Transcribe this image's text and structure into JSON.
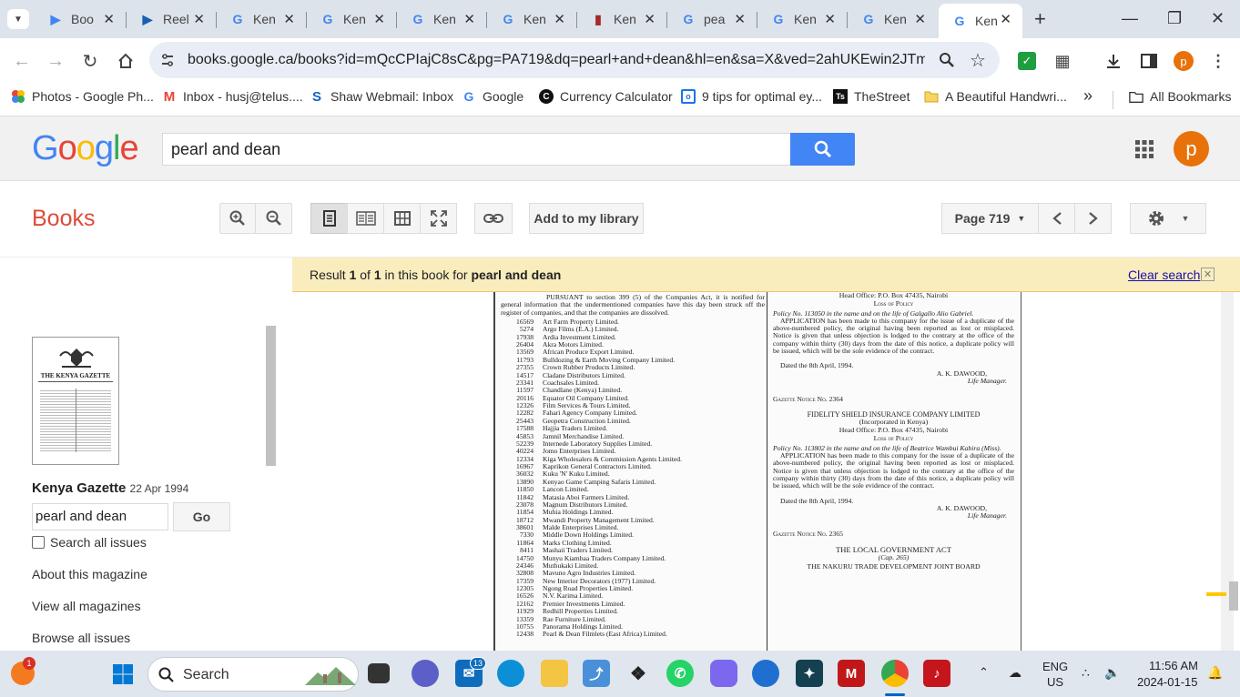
{
  "browser": {
    "tabs": [
      {
        "title": "Boo",
        "icon": "play-icon",
        "color": "#4285f4"
      },
      {
        "title": "Reel",
        "icon": "play-icon",
        "color": "#1a5fb4"
      },
      {
        "title": "Ken",
        "icon": "google-icon",
        "color": "#4285f4"
      },
      {
        "title": "Ken",
        "icon": "google-icon",
        "color": "#4285f4"
      },
      {
        "title": "Ken",
        "icon": "google-icon",
        "color": "#4285f4"
      },
      {
        "title": "Ken",
        "icon": "google-icon",
        "color": "#4285f4"
      },
      {
        "title": "Ken",
        "icon": "wiki-icon",
        "color": "#a52a2a"
      },
      {
        "title": "pea",
        "icon": "google-icon",
        "color": "#4285f4"
      },
      {
        "title": "Ken",
        "icon": "google-icon",
        "color": "#4285f4"
      },
      {
        "title": "Ken",
        "icon": "google-icon",
        "color": "#4285f4"
      },
      {
        "title": "Ken",
        "icon": "google-icon",
        "color": "#4285f4",
        "active": true
      }
    ],
    "url": "books.google.ca/books?id=mQcCPIajC8sC&pg=PA719&dq=pearl+and+dean&hl=en&sa=X&ved=2ahUKEwin2JTmleCDAx...",
    "profile_letter": "p",
    "bookmarks": [
      {
        "label": "Photos - Google Ph...",
        "icon": "photos-icon"
      },
      {
        "label": "Inbox - husj@telus....",
        "icon": "gmail-icon"
      },
      {
        "label": "Shaw Webmail: Inbox",
        "icon": "shaw-icon"
      },
      {
        "label": "Google",
        "icon": "google-icon"
      },
      {
        "label": "Currency Calculator",
        "icon": "currency-icon"
      },
      {
        "label": "9 tips for optimal ey...",
        "icon": "tips-icon"
      },
      {
        "label": "TheStreet",
        "icon": "thestreet-icon"
      },
      {
        "label": "A Beautiful Handwri...",
        "icon": "folder-icon"
      }
    ],
    "all_bookmarks": "All Bookmarks",
    "more": "»"
  },
  "google": {
    "logo": "Google",
    "search_value": "pearl and dean",
    "avatar_letter": "p"
  },
  "books": {
    "title": "Books",
    "add_to_library": "Add to my library",
    "page_selector": "Page 719",
    "result_prefix": "Result ",
    "result_num": "1",
    "result_of": " of ",
    "result_total": "1",
    "result_mid": " in this book for ",
    "result_query": "pearl and dean",
    "clear_search": "Clear search"
  },
  "sidebar": {
    "thumb_title": "THE KENYA GAZETTE",
    "book_title": "Kenya Gazette",
    "book_date": "22 Apr 1994",
    "search_value": "pearl and dean",
    "go": "Go",
    "search_all": "Search all issues",
    "links": [
      "About this magazine",
      "View all magazines",
      "Browse all issues"
    ]
  },
  "gazette": {
    "left_intro": "PURSUANT to section 399 (5) of the Companies Act, it is notified for general information that the undermentioned companies have this day been struck off the register of companies, and that the companies are dissolved.",
    "companies": [
      [
        "16569",
        "Art Farm Property Limited."
      ],
      [
        "5274",
        "Argo Films (E.A.) Limited."
      ],
      [
        "17938",
        "Ardia Investment Limited."
      ],
      [
        "26404",
        "Akra Motors Limited."
      ],
      [
        "13569",
        "African Produce Export Limited."
      ],
      [
        "11793",
        "Bulldozing & Earth Moving Company Limited."
      ],
      [
        "27355",
        "Crown Rubber Products Limited."
      ],
      [
        "14517",
        "Cladane Distributors Limited."
      ],
      [
        "23341",
        "Coachsales Limited."
      ],
      [
        "11597",
        "Chandlane (Kenya) Limited."
      ],
      [
        "20116",
        "Equator Oil Company Limited."
      ],
      [
        "12326",
        "Film Services & Tours Limited."
      ],
      [
        "12282",
        "Fahari Agency Company Limited."
      ],
      [
        "25443",
        "Geopetra Construction Limited."
      ],
      [
        "17588",
        "Hajjia Traders Limited."
      ],
      [
        "45853",
        "Jamnil Merchandise Limited."
      ],
      [
        "52239",
        "Internede Laboratory Supplies Limited."
      ],
      [
        "40224",
        "Jomo Enterprises Limited."
      ],
      [
        "12334",
        "Kiga Wholesalers & Commission Agents Limited."
      ],
      [
        "16967",
        "Kaprikon General Contractors Limited."
      ],
      [
        "36032",
        "Kuku 'N' Kuku Limited."
      ],
      [
        "13890",
        "Kenyao Game Camping Safaris Limited."
      ],
      [
        "11850",
        "Lancon Limited."
      ],
      [
        "11842",
        "Matasia Aboi Farmers Limited."
      ],
      [
        "23078",
        "Magnum Distributors Limited."
      ],
      [
        "11854",
        "Muhia Holdings Limited."
      ],
      [
        "18712",
        "Mwandi Property Management Limited."
      ],
      [
        "38601",
        "Malde Enterprises Limited."
      ],
      [
        "7330",
        "Middle Down Holdings Limited."
      ],
      [
        "11864",
        "Marks Clothing Limited."
      ],
      [
        "8411",
        "Mashaii Traders Limited."
      ],
      [
        "14750",
        "Munyu Kiambaa Traders Company Limited."
      ],
      [
        "24346",
        "Muthukaki Limited."
      ],
      [
        "32808",
        "Mavuno Agro Industries Limited."
      ],
      [
        "17359",
        "New Interior Decorators (1977) Limited."
      ],
      [
        "12305",
        "Ngong Road Properties Limited."
      ],
      [
        "16526",
        "N.V. Karima Limited."
      ],
      [
        "12162",
        "Premier Investments Limited."
      ],
      [
        "11929",
        "Redhill Properties Limited."
      ],
      [
        "13359",
        "Rae Furniture Limited."
      ],
      [
        "10755",
        "Panorama Holdings Limited."
      ],
      [
        "12438",
        "Pearl & Dean Filmlets (East Africa) Limited."
      ]
    ],
    "r_head1": "Head Office: P.O. Box 47435, Nairobi",
    "r_loss1": "Loss of Policy",
    "r_policy1": "Policy No. 113050 in the name and on the life of Galgallo Alio Gabriel.",
    "r_app1": "APPLICATION has been made to this company for the issue of a duplicate of the above-numbered policy, the original having been reported as lost or misplaced. Notice is given that unless objection is lodged to the contrary at the office of the company within thirty (30) days from the date of this notice, a duplicate policy will be issued, which will be the sole evidence of the contract.",
    "r_date1": "Dated the 8th April, 1994.",
    "r_sign1": "A. K. DAWOOD,",
    "r_role1": "Life Manager.",
    "r_notice1": "Gazette Notice No. 2364",
    "r_company": "FIDELITY SHIELD INSURANCE COMPANY LIMITED",
    "r_inc": "(Incorporated in Kenya)",
    "r_head2": "Head Office: P.O. Box 47435, Nairobi",
    "r_loss2": "Loss of Policy",
    "r_policy2": "Policy No. 113802 in the name and on the life of Beatrice Wambui Kabira (Miss).",
    "r_app2": "APPLICATION has been made to this company for the issue of a duplicate of the above-numbered policy, the original having been reported as lost or misplaced. Notice is given that unless objection is lodged to the contrary at the office of the company within thirty (30) days from the date of this notice, a duplicate policy will be issued, which will be the sole evidence of the contract.",
    "r_date2": "Dated the 8th April, 1994.",
    "r_sign2": "A. K. DAWOOD,",
    "r_role2": "Life Manager.",
    "r_notice2": "Gazette Notice No. 2365",
    "r_act": "THE LOCAL GOVERNMENT ACT",
    "r_cap": "(Cap. 265)",
    "r_nakuru": "THE NAKURU TRADE DEVELOPMENT JOINT BOARD"
  },
  "taskbar": {
    "search_placeholder": "Search",
    "badge_notify": "1",
    "badge_mail": "13",
    "lang": "ENG",
    "region": "US",
    "time": "11:56 AM",
    "date": "2024-01-15"
  }
}
